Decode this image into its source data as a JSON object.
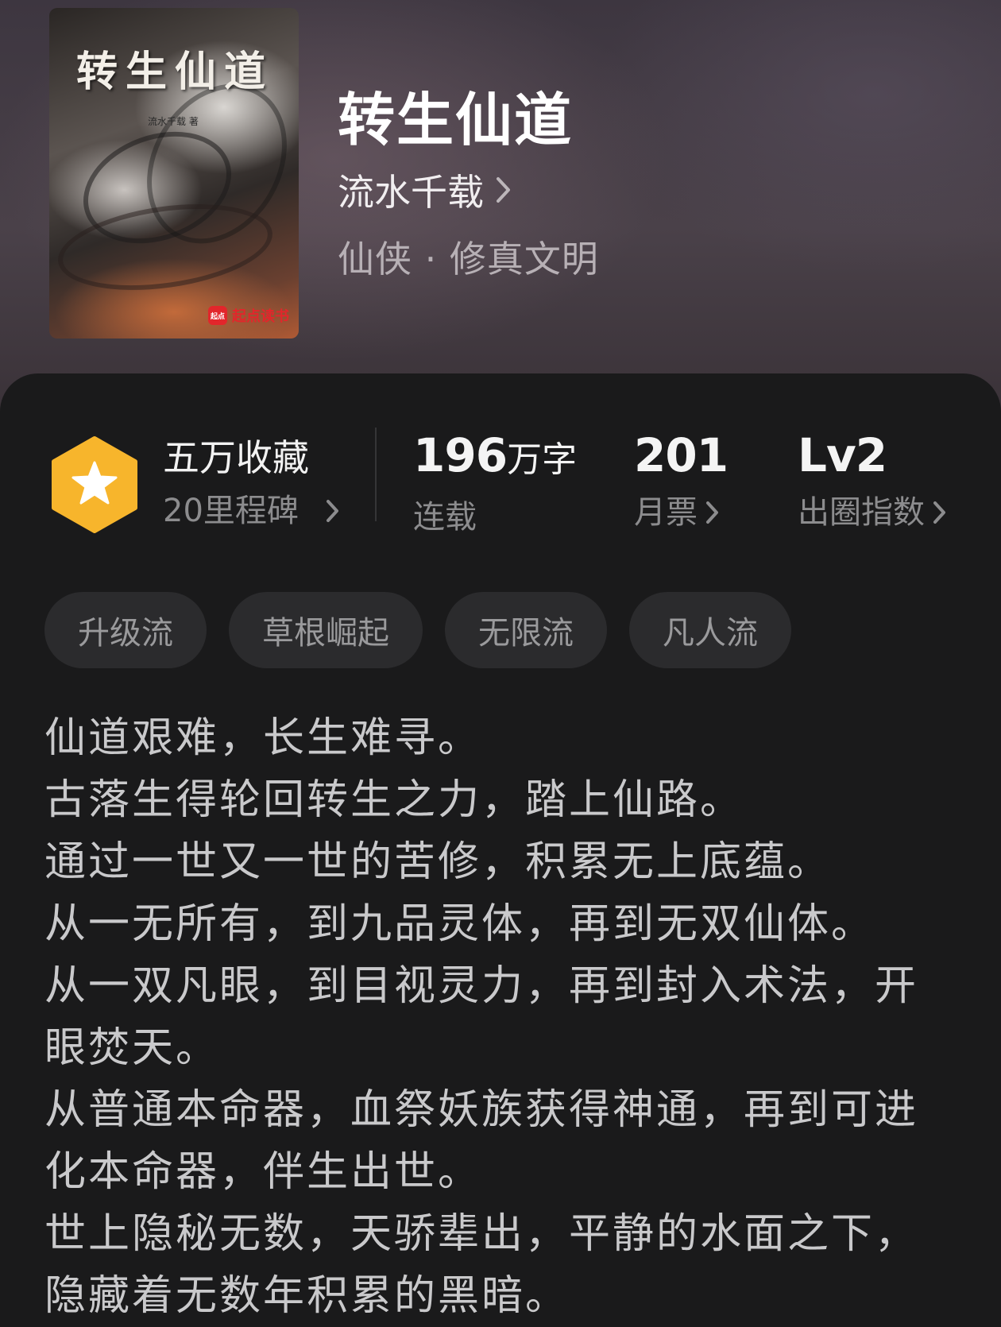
{
  "book": {
    "title": "转生仙道",
    "author": "流水千载",
    "genre": "仙侠 · 修真文明",
    "cover": {
      "title": "转生仙道",
      "author_small": "流水千载 著",
      "brand": "起点读书",
      "brand_mark": "起点"
    }
  },
  "stats": {
    "collection": {
      "label": "五万收藏",
      "sub": "20里程碑"
    },
    "words": {
      "number": "196",
      "unit": "万字",
      "sub": "连载"
    },
    "monthly_votes": {
      "number": "201",
      "sub": "月票"
    },
    "breakout": {
      "number": "Lv2",
      "sub": "出圈指数"
    }
  },
  "tags": [
    "升级流",
    "草根崛起",
    "无限流",
    "凡人流"
  ],
  "synopsis": [
    "仙道艰难，长生难寻。",
    "古落生得轮回转生之力，踏上仙路。",
    "通过一世又一世的苦修，积累无上底蕴。",
    "从一无所有，到九品灵体，再到无双仙体。",
    "从一双凡眼，到目视灵力，再到封入术法，开眼焚天。",
    "从普通本命器，血祭妖族获得神通，再到可进化本命器，伴生出世。",
    "世上隐秘无数，天骄辈出，平静的水面之下，隐藏着无数年积累的黑暗。"
  ],
  "colors": {
    "badge": "#F7B52C",
    "panel": "#1a1a1b",
    "tag_bg": "#2b2b2d"
  },
  "icons": {
    "badge": "star-hexagon-icon",
    "chevron": "chevron-right-icon"
  }
}
